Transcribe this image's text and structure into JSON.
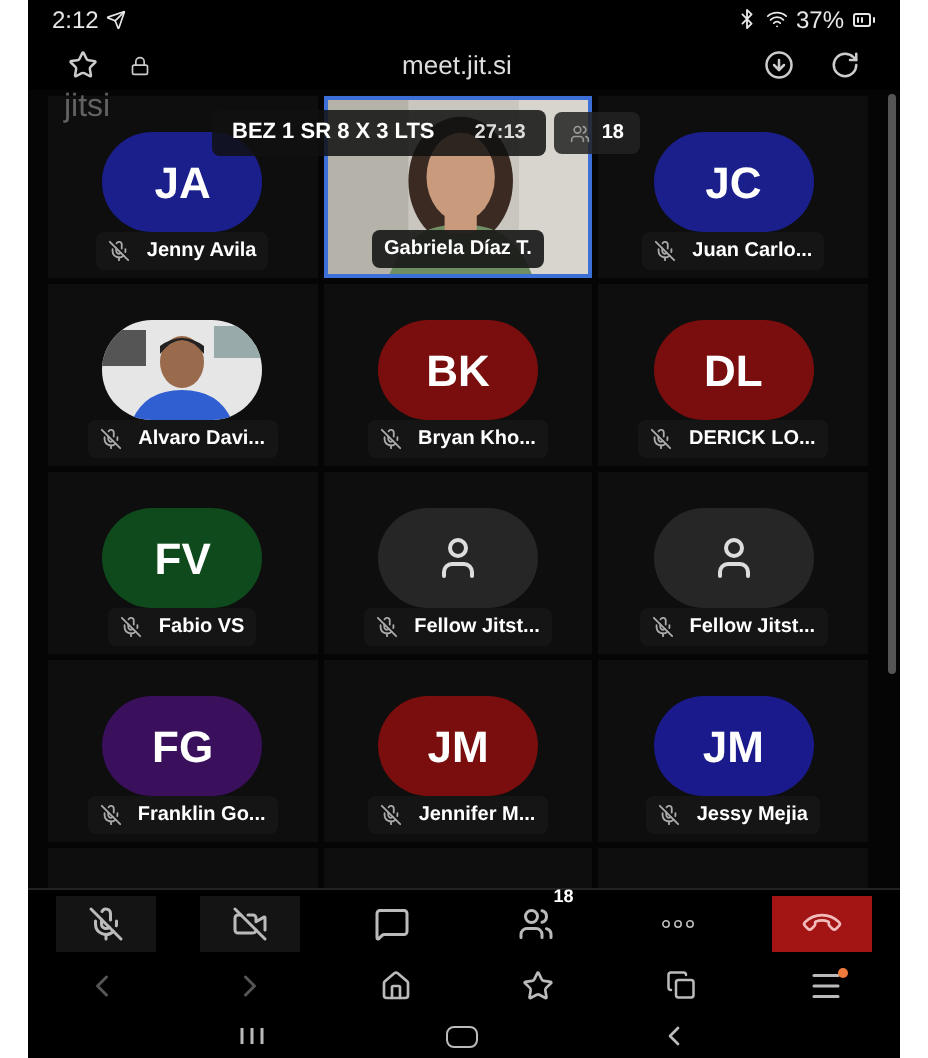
{
  "status_bar": {
    "time": "2:12",
    "battery": "37%"
  },
  "browser": {
    "url": "meet.jit.si"
  },
  "watermark": "jitsi",
  "meeting": {
    "title": "BEZ 1 SR 8 X 3 LTS",
    "timer": "27:13",
    "participant_count": "18"
  },
  "tiles": [
    {
      "kind": "initials",
      "name": "Jenny Avila",
      "initials": "JA",
      "color": "#1a1f8c",
      "muted": true,
      "active": false
    },
    {
      "kind": "video",
      "name": "Gabriela Díaz T.",
      "muted": false,
      "active": true
    },
    {
      "kind": "initials",
      "name": "Juan Carlo...",
      "initials": "JC",
      "color": "#1a1f8c",
      "muted": true,
      "active": false
    },
    {
      "name": "Alvaro Davi...",
      "muted": true,
      "active": false
    },
    {
      "kind": "initials",
      "name": "Bryan Kho...",
      "initials": "BK",
      "color": "#7a0d0d",
      "muted": true,
      "active": false
    },
    {
      "kind": "initials",
      "name": "DERICK LO...",
      "initials": "DL",
      "color": "#7a0d0d",
      "muted": true,
      "active": false
    },
    {
      "kind": "initials",
      "name": "Fabio VS",
      "initials": "FV",
      "color": "#0f4a1c",
      "muted": true,
      "active": false
    },
    {
      "kind": "placeholder",
      "name": "Fellow Jitst...",
      "muted": true,
      "active": false
    },
    {
      "kind": "placeholder",
      "name": "Fellow Jitst...",
      "muted": true,
      "active": false
    },
    {
      "kind": "initials",
      "name": "Franklin Go...",
      "initials": "FG",
      "color": "#3a0f5c",
      "muted": true,
      "active": false
    },
    {
      "kind": "initials",
      "name": "Jennifer M...",
      "initials": "JM",
      "color": "#7a0d0d",
      "muted": true,
      "active": false
    },
    {
      "kind": "initials",
      "name": "Jessy Mejia",
      "initials": "JM",
      "color": "#1a1a8c",
      "muted": true,
      "active": false
    }
  ],
  "toolbar": [
    {
      "kind": "mic",
      "off": true
    },
    {
      "kind": "camera",
      "off": true
    },
    {
      "kind": "chat"
    },
    {
      "kind": "participants",
      "badge": "18"
    },
    {
      "kind": "more"
    },
    {
      "kind": "hangup"
    }
  ]
}
